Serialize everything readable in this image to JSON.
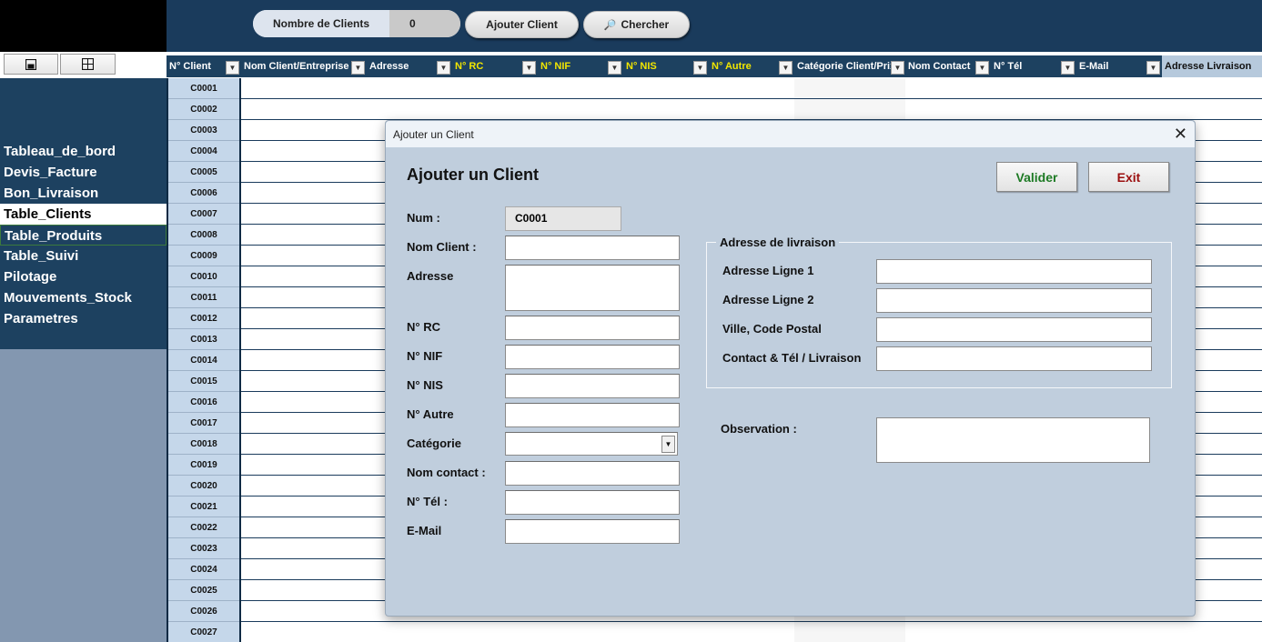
{
  "toolbar": {
    "count_label": "Nombre de Clients",
    "count_value": "0",
    "add_label": "Ajouter Client",
    "search_label": "Chercher"
  },
  "view_buttons": [
    "save-view",
    "grid-view"
  ],
  "sidebar": {
    "items": [
      {
        "label": "Tableau_de_bord"
      },
      {
        "label": "Devis_Facture"
      },
      {
        "label": "Bon_Livraison"
      },
      {
        "label": "Table_Clients"
      },
      {
        "label": "Table_Produits"
      },
      {
        "label": "Table_Suivi"
      },
      {
        "label": "Pilotage"
      },
      {
        "label": "Mouvements_Stock"
      },
      {
        "label": "Parametres"
      }
    ]
  },
  "table": {
    "headers": [
      "N° Client",
      "Nom Client/Entreprise",
      "Adresse",
      "N° RC",
      "N° NIF",
      "N° NIS",
      "N° Autre",
      "Catégorie Client/Prix",
      "Nom Contact",
      "N° Tél",
      "E-Mail",
      "Adresse Livraison"
    ],
    "ids": [
      "C0001",
      "C0002",
      "C0003",
      "C0004",
      "C0005",
      "C0006",
      "C0007",
      "C0008",
      "C0009",
      "C0010",
      "C0011",
      "C0012",
      "C0013",
      "C0014",
      "C0015",
      "C0016",
      "C0017",
      "C0018",
      "C0019",
      "C0020",
      "C0021",
      "C0022",
      "C0023",
      "C0024",
      "C0025",
      "C0026",
      "C0027"
    ]
  },
  "dialog": {
    "window_title": "Ajouter un Client",
    "heading": "Ajouter un Client",
    "valider_label": "Valider",
    "exit_label": "Exit",
    "close_glyph": "✕",
    "fields": {
      "num_label": "Num  :",
      "num_value": "C0001",
      "nom_client_label": "Nom Client :",
      "adresse_label": "Adresse",
      "rc_label": "N° RC",
      "nif_label": "N° NIF",
      "nis_label": "N° NIS",
      "autre_label": "N° Autre",
      "categorie_label": "Catégorie",
      "nom_contact_label": "Nom contact :",
      "tel_label": "N° Tél :",
      "email_label": "E-Mail"
    },
    "delivery": {
      "group_title": "Adresse de livraison",
      "line1_label": "Adresse Ligne 1",
      "line2_label": "Adresse Ligne 2",
      "city_label": "Ville, Code Postal",
      "contact_label": "Contact & Tél / Livraison"
    },
    "observation_label": "Observation :"
  }
}
